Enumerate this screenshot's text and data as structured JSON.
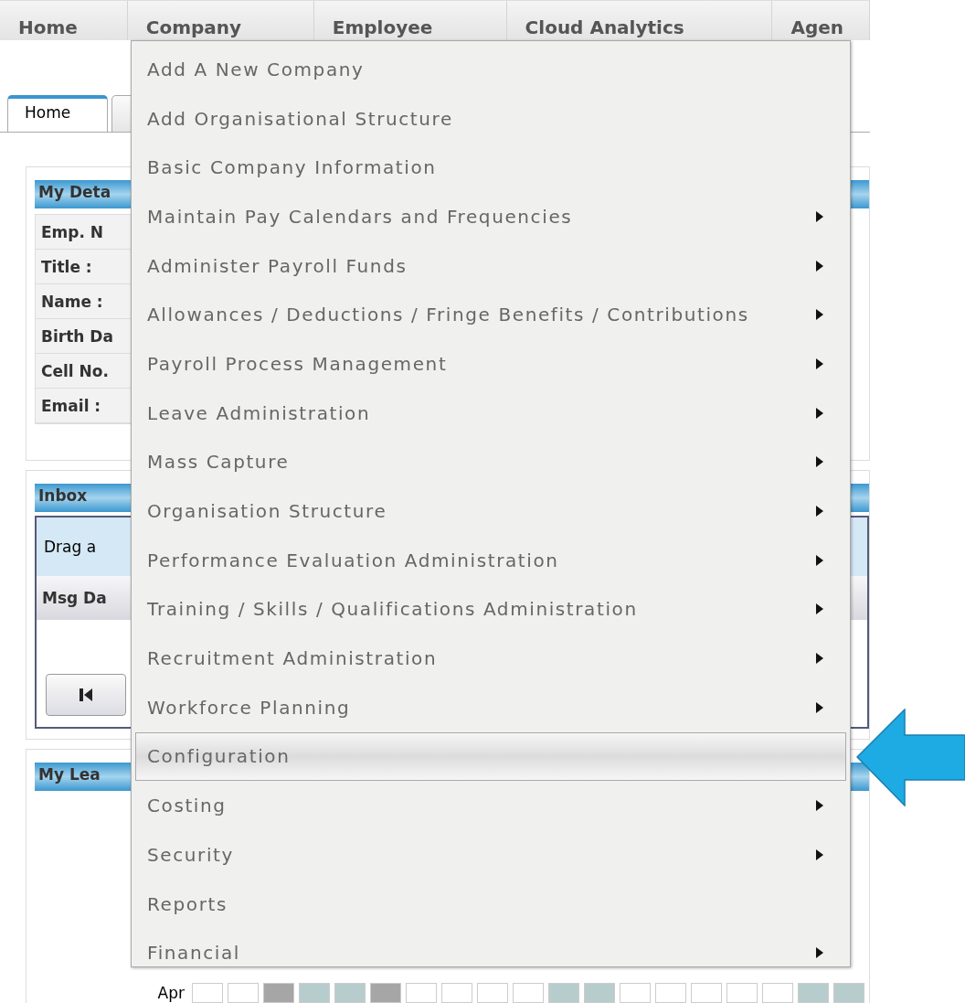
{
  "nav": [
    {
      "label": "Home"
    },
    {
      "label": "Company"
    },
    {
      "label": "Employee"
    },
    {
      "label": "Cloud Analytics"
    },
    {
      "label": "Agen"
    }
  ],
  "tabs": [
    {
      "label": "Home",
      "selected": true
    },
    {
      "selected": false
    }
  ],
  "my_details": {
    "title": "My Deta",
    "fields": [
      "Emp. N",
      "Title :",
      "Name :",
      "Birth Da",
      "Cell No.",
      "Email :"
    ]
  },
  "inbox": {
    "title": "Inbox",
    "group_hint": "Drag a",
    "column_1": "Msg Da"
  },
  "my_leave": {
    "title": "My Lea",
    "month": "Apr",
    "days": [
      {
        "color": "#ffffff"
      },
      {
        "color": "#ffffff"
      },
      {
        "color": "#a6a6a6"
      },
      {
        "color": "#b7cccd"
      },
      {
        "color": "#b7cccd"
      },
      {
        "color": "#a6a6a6"
      },
      {
        "color": "#ffffff"
      },
      {
        "color": "#ffffff"
      },
      {
        "color": "#ffffff"
      },
      {
        "color": "#ffffff"
      },
      {
        "color": "#b7cccd"
      },
      {
        "color": "#b7cccd"
      },
      {
        "color": "#ffffff"
      },
      {
        "color": "#ffffff"
      },
      {
        "color": "#ffffff"
      },
      {
        "color": "#ffffff"
      },
      {
        "color": "#ffffff"
      },
      {
        "color": "#b7cccd"
      },
      {
        "color": "#b7cccd"
      }
    ]
  },
  "menu": [
    {
      "label": "Add A New Company",
      "submenu": false,
      "selected": false
    },
    {
      "label": "Add Organisational Structure",
      "submenu": false,
      "selected": false
    },
    {
      "label": "Basic Company Information",
      "submenu": false,
      "selected": false
    },
    {
      "label": "Maintain Pay Calendars and Frequencies",
      "submenu": true,
      "selected": false
    },
    {
      "label": "Administer Payroll Funds",
      "submenu": true,
      "selected": false
    },
    {
      "label": "Allowances / Deductions / Fringe Benefits / Contributions",
      "submenu": true,
      "selected": false
    },
    {
      "label": "Payroll Process Management",
      "submenu": true,
      "selected": false
    },
    {
      "label": "Leave Administration",
      "submenu": true,
      "selected": false
    },
    {
      "label": "Mass Capture",
      "submenu": true,
      "selected": false
    },
    {
      "label": "Organisation Structure",
      "submenu": true,
      "selected": false
    },
    {
      "label": "Performance Evaluation Administration",
      "submenu": true,
      "selected": false
    },
    {
      "label": "Training / Skills / Qualifications Administration",
      "submenu": true,
      "selected": false
    },
    {
      "label": "Recruitment Administration",
      "submenu": true,
      "selected": false
    },
    {
      "label": "Workforce Planning",
      "submenu": true,
      "selected": false
    },
    {
      "label": "Configuration",
      "submenu": false,
      "selected": true
    },
    {
      "label": "Costing",
      "submenu": true,
      "selected": false
    },
    {
      "label": "Security",
      "submenu": true,
      "selected": false
    },
    {
      "label": "Reports",
      "submenu": false,
      "selected": false
    },
    {
      "label": "Financial",
      "submenu": true,
      "selected": false
    }
  ]
}
